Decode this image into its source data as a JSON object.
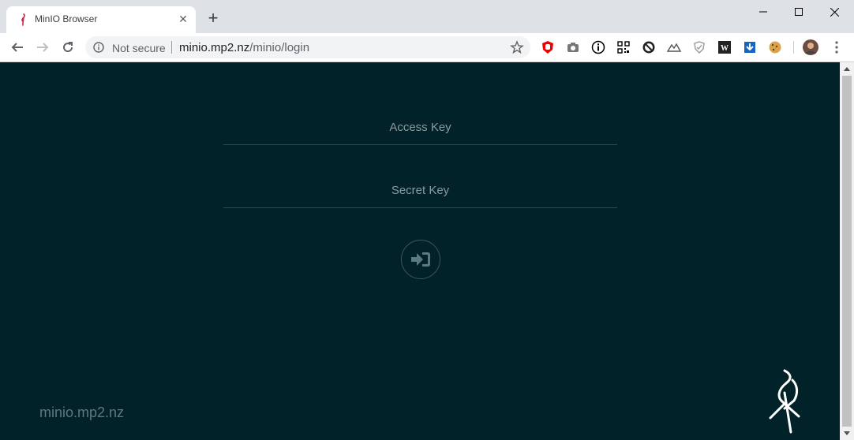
{
  "browser": {
    "tab": {
      "title": "MinIO Browser",
      "favicon": "minio-heron-icon"
    },
    "address_bar": {
      "security_label": "Not secure",
      "url_host": "minio.mp2.nz",
      "url_path": "/minio/login"
    },
    "extensions": [
      "ublock-icon",
      "camera-icon",
      "info-icon",
      "qr-code-icon",
      "no-script-icon",
      "mountain-icon",
      "shield-icon",
      "wikipedia-icon",
      "download-icon",
      "cookie-icon",
      "profile-avatar"
    ],
    "window_controls": [
      "minimize-icon",
      "maximize-icon",
      "close-icon"
    ]
  },
  "login": {
    "access_key_placeholder": "Access Key",
    "secret_key_placeholder": "Secret Key",
    "access_key_value": "",
    "secret_key_value": "",
    "submit_icon": "sign-in-icon"
  },
  "footer": {
    "host": "minio.mp2.nz"
  },
  "colors": {
    "page_background": "#012229",
    "input_underline": "#2f4a51",
    "placeholder": "#8d9a9d",
    "host_label": "#5c7a80"
  }
}
